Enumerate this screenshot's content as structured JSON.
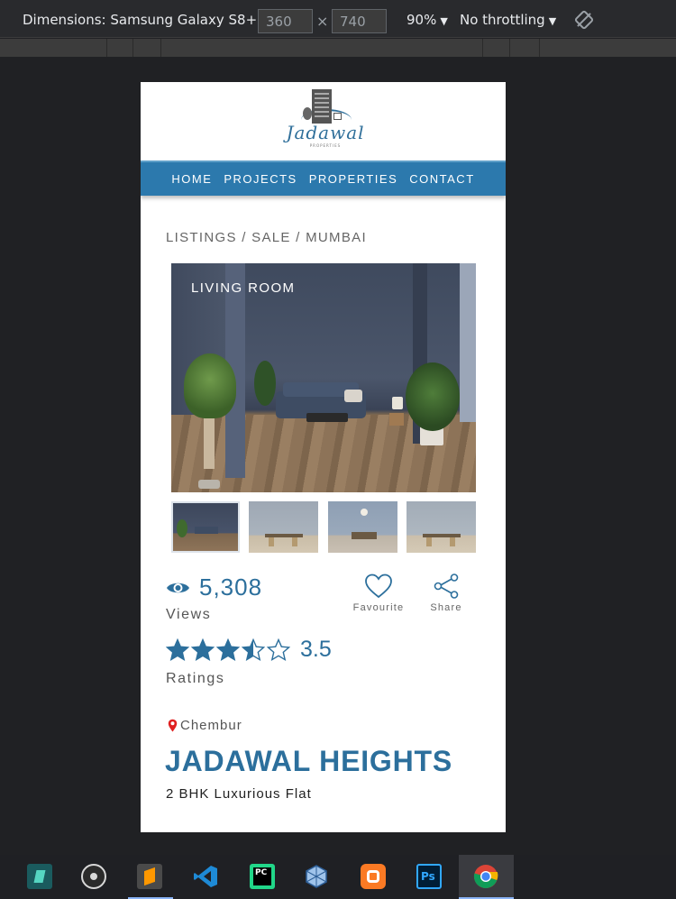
{
  "devtools": {
    "device_label": "Dimensions: Samsung Galaxy S8+",
    "caret": "▼",
    "width_value": "360",
    "height_value": "740",
    "times": "×",
    "zoom": "90%",
    "throttling": "No throttling"
  },
  "site": {
    "logo_text": "Jadawal",
    "logo_sub": "PROPERTIES",
    "nav": [
      "HOME",
      "PROJECTS",
      "PROPERTIES",
      "CONTACT"
    ],
    "breadcrumb": "LISTINGS / SALE / MUMBAI",
    "main_photo_label": "LIVING ROOM",
    "views_count": "5,308",
    "views_label": "Views",
    "favourite_label": "Favourite",
    "share_label": "Share",
    "rating_value": "3.5",
    "rating_stars": 3.5,
    "ratings_label": "Ratings",
    "location": "Chembur",
    "title": "JADAWAL HEIGHTS",
    "subtitle": "2 BHK Luxurious Flat",
    "accent_color": "#2c79ad",
    "text_blue": "#2c6f9c",
    "pin_color": "#e02020"
  },
  "taskbar": {
    "apps": [
      "filmora-icon",
      "obs-icon",
      "sublime-text-icon",
      "vscode-icon",
      "pycharm-icon",
      "virtualbox-icon",
      "xampp-icon",
      "photoshop-icon",
      "chrome-icon"
    ]
  }
}
